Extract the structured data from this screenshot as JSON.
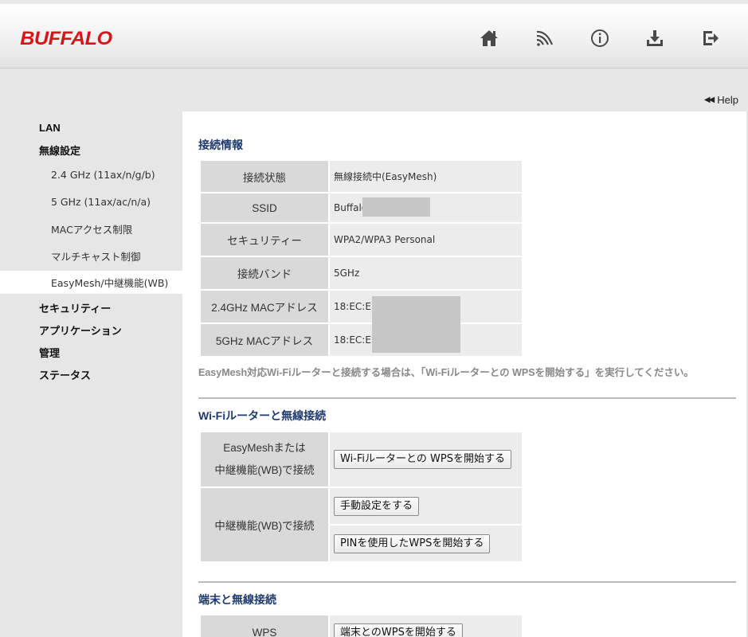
{
  "header": {
    "logo": "BUFFALO",
    "icons": [
      "home-icon",
      "wireless-icon",
      "info-icon",
      "download-icon",
      "logout-icon"
    ]
  },
  "help": {
    "label": "Help"
  },
  "sidebar": {
    "items": [
      {
        "label": "LAN"
      },
      {
        "label": "無線設定"
      },
      {
        "label": "2.4 GHz (11ax/n/g/b)"
      },
      {
        "label": "5 GHz (11ax/ac/n/a)"
      },
      {
        "label": "MACアクセス制限"
      },
      {
        "label": "マルチキャスト制御"
      },
      {
        "label": "EasyMesh/中継機能(WB)"
      },
      {
        "label": "セキュリティー"
      },
      {
        "label": "アプリケーション"
      },
      {
        "label": "管理"
      },
      {
        "label": "ステータス"
      }
    ]
  },
  "connection_info": {
    "title": "接続情報",
    "rows": [
      {
        "label": "接続状態",
        "value": "無線接続中(EasyMesh)"
      },
      {
        "label": "SSID",
        "value": "Buffalo-"
      },
      {
        "label": "セキュリティー",
        "value": "WPA2/WPA3 Personal"
      },
      {
        "label": "接続バンド",
        "value": "5GHz"
      },
      {
        "label": "2.4GHz MACアドレス",
        "value": "18:EC:E7"
      },
      {
        "label": "5GHz MACアドレス",
        "value": "18:EC:E7"
      }
    ],
    "note": "EasyMesh対応Wi-Fiルーターと接続する場合は、「Wi-Fiルーターとの WPSを開始する」を実行してください。"
  },
  "router_connect": {
    "title": "Wi-Fiルーターと無線接続",
    "row1_label_line1": "EasyMeshまたは",
    "row1_label_line2": "中継機能(WB)で接続",
    "row1_button": "Wi-Fiルーターとの WPSを開始する",
    "row2_label": "中継機能(WB)で接続",
    "row2_button1": "手動設定をする",
    "row2_button2": "PINを使用したWPSを開始する"
  },
  "device_connect": {
    "title": "端末と無線接続",
    "row1_label": "WPS",
    "row1_button": "端末とのWPSを開始する"
  }
}
